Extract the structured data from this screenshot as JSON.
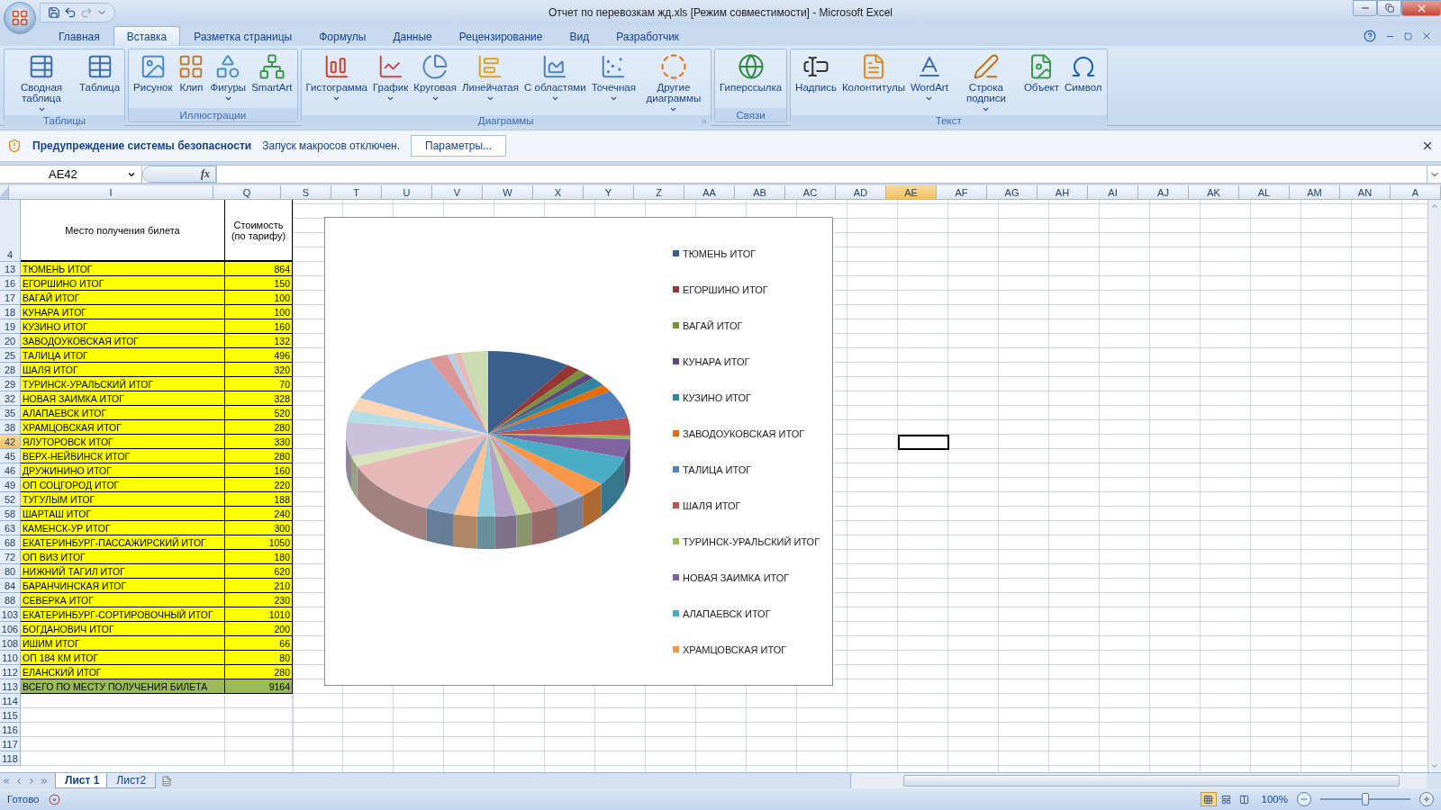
{
  "window": {
    "title": "Отчет по перевозкам жд.xls  [Режим совместимости] - Microsoft Excel"
  },
  "ribbon_tabs": [
    {
      "label": "Главная",
      "selected": false
    },
    {
      "label": "Вставка",
      "selected": true
    },
    {
      "label": "Разметка страницы",
      "selected": false
    },
    {
      "label": "Формулы",
      "selected": false
    },
    {
      "label": "Данные",
      "selected": false
    },
    {
      "label": "Рецензирование",
      "selected": false
    },
    {
      "label": "Вид",
      "selected": false
    },
    {
      "label": "Разработчик",
      "selected": false
    }
  ],
  "ribbon_groups": [
    {
      "label": "Таблицы",
      "launcher": false,
      "buttons": [
        {
          "label": "Сводная таблица",
          "dropdown": true
        },
        {
          "label": "Таблица",
          "dropdown": false
        }
      ]
    },
    {
      "label": "Иллюстрации",
      "launcher": false,
      "buttons": [
        {
          "label": "Рисунок",
          "dropdown": false
        },
        {
          "label": "Клип",
          "dropdown": false
        },
        {
          "label": "Фигуры",
          "dropdown": true
        },
        {
          "label": "SmartArt",
          "dropdown": false
        }
      ]
    },
    {
      "label": "Диаграммы",
      "launcher": true,
      "buttons": [
        {
          "label": "Гистограмма",
          "dropdown": true
        },
        {
          "label": "График",
          "dropdown": true
        },
        {
          "label": "Круговая",
          "dropdown": true
        },
        {
          "label": "Линейчатая",
          "dropdown": true
        },
        {
          "label": "С областями",
          "dropdown": true
        },
        {
          "label": "Точечная",
          "dropdown": true
        },
        {
          "label": "Другие диаграммы",
          "dropdown": true
        }
      ]
    },
    {
      "label": "Связи",
      "launcher": false,
      "buttons": [
        {
          "label": "Гиперссылка",
          "dropdown": false
        }
      ]
    },
    {
      "label": "Текст",
      "launcher": false,
      "buttons": [
        {
          "label": "Надпись",
          "dropdown": false
        },
        {
          "label": "Колонтитулы",
          "dropdown": false
        },
        {
          "label": "WordArt",
          "dropdown": true
        },
        {
          "label": "Строка подписи",
          "dropdown": true
        },
        {
          "label": "Объект",
          "dropdown": false
        },
        {
          "label": "Символ",
          "dropdown": false
        }
      ]
    }
  ],
  "security_bar": {
    "title": "Предупреждение системы безопасности",
    "message": "Запуск макросов отключен.",
    "button": "Параметры..."
  },
  "formula_bar": {
    "name_box": "AE42",
    "fx": "fx"
  },
  "columns": [
    {
      "label": "I",
      "selected": false
    },
    {
      "label": "Q",
      "selected": false
    },
    {
      "label": "S",
      "selected": false
    },
    {
      "label": "T",
      "selected": false
    },
    {
      "label": "U",
      "selected": false
    },
    {
      "label": "V",
      "selected": false
    },
    {
      "label": "W",
      "selected": false
    },
    {
      "label": "X",
      "selected": false
    },
    {
      "label": "Y",
      "selected": false
    },
    {
      "label": "Z",
      "selected": false
    },
    {
      "label": "AA",
      "selected": false
    },
    {
      "label": "AB",
      "selected": false
    },
    {
      "label": "AC",
      "selected": false
    },
    {
      "label": "AD",
      "selected": false
    },
    {
      "label": "AE",
      "selected": true
    },
    {
      "label": "AF",
      "selected": false
    },
    {
      "label": "AG",
      "selected": false
    },
    {
      "label": "AH",
      "selected": false
    },
    {
      "label": "AI",
      "selected": false
    },
    {
      "label": "AJ",
      "selected": false
    },
    {
      "label": "AK",
      "selected": false
    },
    {
      "label": "AL",
      "selected": false
    },
    {
      "label": "AM",
      "selected": false
    },
    {
      "label": "AN",
      "selected": false
    },
    {
      "label": "A",
      "selected": false
    }
  ],
  "table": {
    "header_row": "4",
    "headers": [
      "Место получения билета",
      "Стоимость (по тарифу)"
    ],
    "rows": [
      {
        "row": "13",
        "place": "ТЮМЕНЬ ИТОГ",
        "cost": "864",
        "selected": false
      },
      {
        "row": "16",
        "place": "ЕГОРШИНО ИТОГ",
        "cost": "150",
        "selected": false
      },
      {
        "row": "17",
        "place": "ВАГАЙ ИТОГ",
        "cost": "100",
        "selected": false
      },
      {
        "row": "18",
        "place": "КУНАРА ИТОГ",
        "cost": "100",
        "selected": false
      },
      {
        "row": "19",
        "place": "КУЗИНО ИТОГ",
        "cost": "160",
        "selected": false
      },
      {
        "row": "20",
        "place": "ЗАВОДОУКОВСКАЯ ИТОГ",
        "cost": "132",
        "selected": false
      },
      {
        "row": "25",
        "place": "ТАЛИЦА ИТОГ",
        "cost": "496",
        "selected": false
      },
      {
        "row": "28",
        "place": "ШАЛЯ ИТОГ",
        "cost": "320",
        "selected": false
      },
      {
        "row": "29",
        "place": "ТУРИНСК-УРАЛЬСКИЙ ИТОГ",
        "cost": "70",
        "selected": false
      },
      {
        "row": "32",
        "place": "НОВАЯ ЗАИМКА ИТОГ",
        "cost": "328",
        "selected": false
      },
      {
        "row": "35",
        "place": "АЛАПАЕВСК ИТОГ",
        "cost": "520",
        "selected": false
      },
      {
        "row": "38",
        "place": "ХРАМЦОВСКАЯ ИТОГ",
        "cost": "280",
        "selected": false
      },
      {
        "row": "42",
        "place": "ЯЛУТОРОВСК ИТОГ",
        "cost": "330",
        "selected": true
      },
      {
        "row": "45",
        "place": "ВЕРХ-НЕЙВИНСК ИТОГ",
        "cost": "280",
        "selected": false
      },
      {
        "row": "46",
        "place": "ДРУЖИНИНО ИТОГ",
        "cost": "160",
        "selected": false
      },
      {
        "row": "49",
        "place": "ОП СОЦГОРОД ИТОГ",
        "cost": "220",
        "selected": false
      },
      {
        "row": "52",
        "place": "ТУГУЛЫМ ИТОГ",
        "cost": "188",
        "selected": false
      },
      {
        "row": "58",
        "place": "ШАРТАШ ИТОГ",
        "cost": "240",
        "selected": false
      },
      {
        "row": "63",
        "place": "КАМЕНСК-УР ИТОГ",
        "cost": "300",
        "selected": false
      },
      {
        "row": "68",
        "place": "ЕКАТЕРИНБУРГ-ПАССАЖИРСКИЙ ИТОГ",
        "cost": "1050",
        "selected": false
      },
      {
        "row": "72",
        "place": "ОП ВИЗ ИТОГ",
        "cost": "180",
        "selected": false
      },
      {
        "row": "80",
        "place": "НИЖНИЙ ТАГИЛ ИТОГ",
        "cost": "620",
        "selected": false
      },
      {
        "row": "84",
        "place": "БАРАНЧИНСКАЯ ИТОГ",
        "cost": "210",
        "selected": false
      },
      {
        "row": "88",
        "place": "СЕВЕРКА ИТОГ",
        "cost": "230",
        "selected": false
      },
      {
        "row": "103",
        "place": "ЕКАТЕРИНБУРГ-СОРТИРОВОЧНЫЙ ИТОГ",
        "cost": "1010",
        "selected": false
      },
      {
        "row": "106",
        "place": "БОГДАНОВИЧ ИТОГ",
        "cost": "200",
        "selected": false
      },
      {
        "row": "108",
        "place": "ИШИМ ИТОГ",
        "cost": "66",
        "selected": false
      },
      {
        "row": "110",
        "place": "ОП 184 КМ ИТОГ",
        "cost": "80",
        "selected": false
      },
      {
        "row": "112",
        "place": "ЕЛАНСКИЙ ИТОГ",
        "cost": "280",
        "selected": false
      }
    ],
    "total": {
      "row": "113",
      "place": "ВСЕГО ПО МЕСТУ ПОЛУЧЕНИЯ БИЛЕТА",
      "cost": "9164"
    },
    "empty_rows": [
      "114",
      "115",
      "116",
      "117",
      "118"
    ]
  },
  "chart": {
    "legend": [
      {
        "label": "ТЮМЕНЬ ИТОГ",
        "color": "#3a5f8c"
      },
      {
        "label": "ЕГОРШИНО ИТОГ",
        "color": "#953735"
      },
      {
        "label": "ВАГАЙ ИТОГ",
        "color": "#77933c"
      },
      {
        "label": "КУНАРА ИТОГ",
        "color": "#604a7b"
      },
      {
        "label": "КУЗИНО ИТОГ",
        "color": "#31859c"
      },
      {
        "label": "ЗАВОДОУКОВСКАЯ ИТОГ",
        "color": "#e46c0a"
      },
      {
        "label": "ТАЛИЦА ИТОГ",
        "color": "#4f81bd"
      },
      {
        "label": "ШАЛЯ ИТОГ",
        "color": "#c0504d"
      },
      {
        "label": "ТУРИНСК-УРАЛЬСКИЙ ИТОГ",
        "color": "#9bbb59"
      },
      {
        "label": "НОВАЯ ЗАИМКА ИТОГ",
        "color": "#8064a2"
      },
      {
        "label": "АЛАПАЕВСК ИТОГ",
        "color": "#4bacc6"
      },
      {
        "label": "ХРАМЦОВСКАЯ ИТОГ",
        "color": "#f79646"
      }
    ]
  },
  "sheet_tabs": [
    {
      "label": "Лист 1",
      "selected": true
    },
    {
      "label": "Лист2",
      "selected": false
    }
  ],
  "status_bar": {
    "status": "Готово",
    "views": [
      {
        "selected": true
      },
      {
        "selected": false
      },
      {
        "selected": false
      }
    ],
    "zoom": "100%",
    "zoom_slider": {
      "level": 0.5
    }
  }
}
